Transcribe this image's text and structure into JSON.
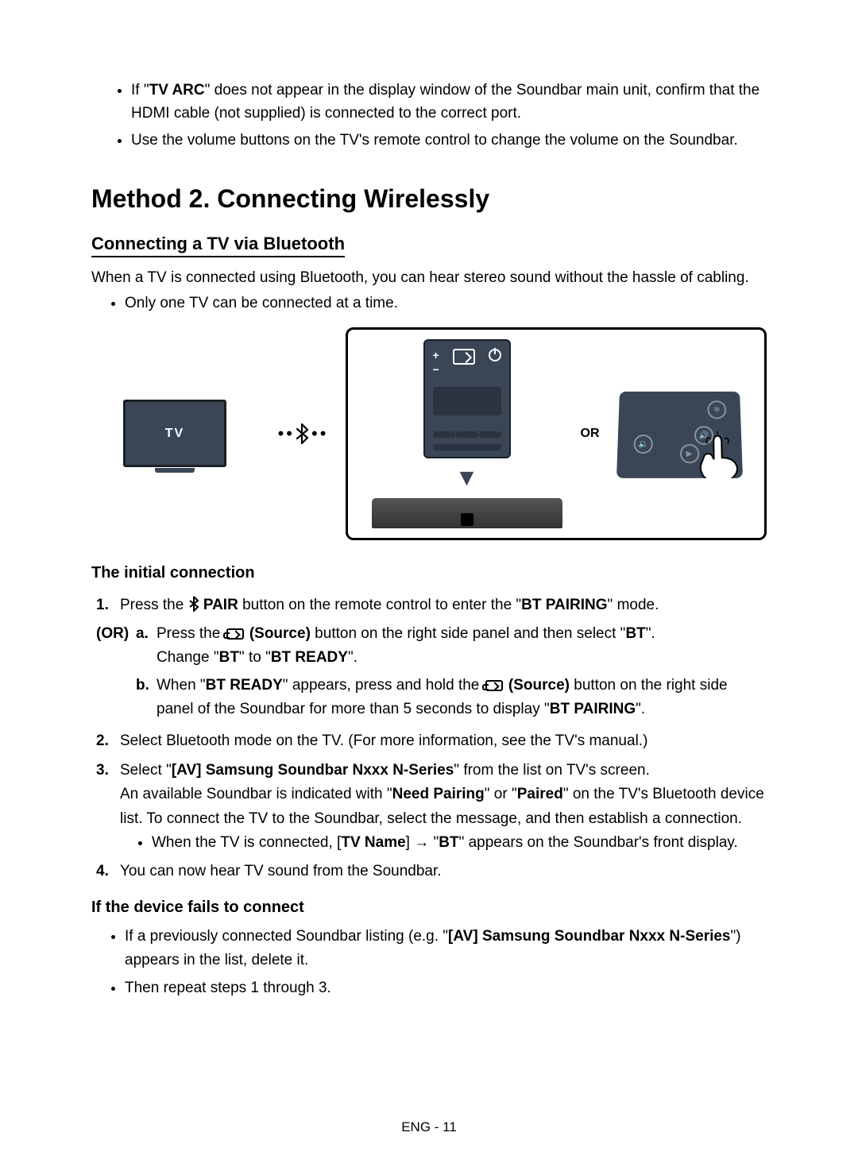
{
  "top": {
    "b1a": "If \"",
    "b1b": "TV ARC",
    "b1c": "\" does not appear in the display window of the Soundbar main unit, confirm that the HDMI cable (not supplied) is connected to the correct port.",
    "b2": "Use the volume buttons on the TV's remote control to change the volume on the Soundbar."
  },
  "method_title": "Method 2. Connecting Wirelessly",
  "sub_title": "Connecting a TV via Bluetooth",
  "intro": "When a TV is connected using Bluetooth, you can hear stereo sound without the hassle of cabling.",
  "intro_bullet": "Only one TV can be connected at a time.",
  "tv_label": "TV",
  "or_label": "OR",
  "initial_title": "The initial connection",
  "step1": {
    "pre": "Press the ",
    "pair": " PAIR",
    "post": " button on the remote control to enter the \"",
    "mode": "BT PAIRING",
    "end": "\" mode."
  },
  "or_marker": "(OR)",
  "step_a": {
    "pre": "Press the ",
    "src": " (Source)",
    "mid": " button on the right side panel and then select \"",
    "bt": "BT",
    "end": "\".",
    "line2a": "Change \"",
    "line2b": "BT",
    "line2c": "\" to \"",
    "line2d": "BT READY",
    "line2e": "\"."
  },
  "step_b": {
    "pre": "When \"",
    "ready": "BT READY",
    "mid": "\" appears, press and hold the ",
    "src": " (Source)",
    "mid2": " button on the right side panel of the Soundbar for more than 5 seconds to display \"",
    "pairing": "BT PAIRING",
    "end": "\"."
  },
  "step2": "Select Bluetooth mode on the TV. (For more information, see the TV's manual.)",
  "step3": {
    "l1a": "Select \"",
    "l1b": "[AV] Samsung Soundbar Nxxx N-Series",
    "l1c": "\" from the list on TV's screen.",
    "l2a": "An available Soundbar is indicated with \"",
    "l2b": "Need Pairing",
    "l2c": "\" or \"",
    "l2d": "Paired",
    "l2e": "\" on the TV's Bluetooth device list. To connect the TV to the Soundbar, select the message, and then establish a connection.",
    "ba": "When the TV is connected, [",
    "bb": "TV Name",
    "bc": "] → \"",
    "bd": "BT",
    "be": "\" appears on the Soundbar's front display."
  },
  "step4": "You can now hear TV sound from the Soundbar.",
  "fail_title": "If the device fails to connect",
  "fail1a": "If a previously connected Soundbar listing (e.g. \"",
  "fail1b": "[AV] Samsung Soundbar Nxxx N-Series",
  "fail1c": "\") appears in the list, delete it.",
  "fail2": "Then repeat steps 1 through 3.",
  "footer": "ENG - 11"
}
